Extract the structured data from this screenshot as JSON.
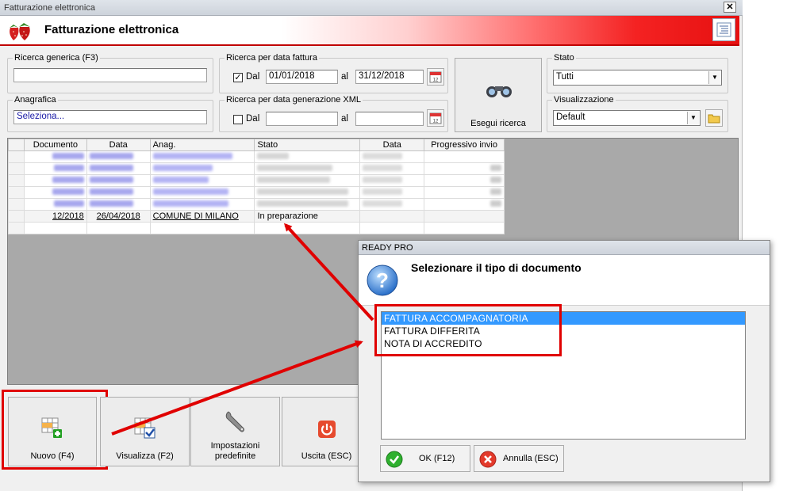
{
  "window": {
    "title": "Fatturazione elettronica",
    "close_label": "✕"
  },
  "banner": {
    "title": "Fatturazione elettronica"
  },
  "search": {
    "generic_label": "Ricerca generica (F3)",
    "generic_value": "",
    "anagrafica_label": "Anagrafica",
    "anagrafica_value": "Seleziona..."
  },
  "date_filter": {
    "label": "Ricerca per data fattura",
    "checked": true,
    "dal_label": "Dal",
    "from": "01/01/2018",
    "al_label": "al",
    "to": "31/12/2018"
  },
  "xml_filter": {
    "label": "Ricerca per data generazione XML",
    "checked": false,
    "dal_label": "Dal",
    "from": "",
    "al_label": "al",
    "to": ""
  },
  "execute": {
    "label": "Esegui ricerca"
  },
  "stato": {
    "label": "Stato",
    "value": "Tutti"
  },
  "visualizzazione": {
    "label": "Visualizzazione",
    "value": "Default"
  },
  "grid": {
    "columns": [
      "Documento",
      "Data",
      "Anag.",
      "Stato",
      "Data",
      "Progressivo invio"
    ],
    "visible_row": {
      "documento": "12/2018",
      "data": "26/04/2018",
      "anag": "COMUNE DI MILANO",
      "stato": "In preparazione",
      "data2": "",
      "progressivo": ""
    }
  },
  "toolbar": {
    "nuovo": "Nuovo (F4)",
    "visualizza": "Visualizza (F2)",
    "impostazioni_line1": "Impostazioni",
    "impostazioni_line2": "predefinite",
    "uscita": "Uscita (ESC)"
  },
  "dialog": {
    "title": "READY PRO",
    "heading": "Selezionare il tipo di documento",
    "options": [
      "FATTURA ACCOMPAGNATORIA",
      "FATTURA DIFFERITA",
      "NOTA DI ACCREDITO"
    ],
    "selected_index": 0,
    "ok_label": "OK (F12)",
    "cancel_label": "Annulla (ESC)"
  },
  "colors": {
    "accent_red": "#e00000",
    "selection_blue": "#3399ff",
    "banner_red": "#e61010"
  }
}
